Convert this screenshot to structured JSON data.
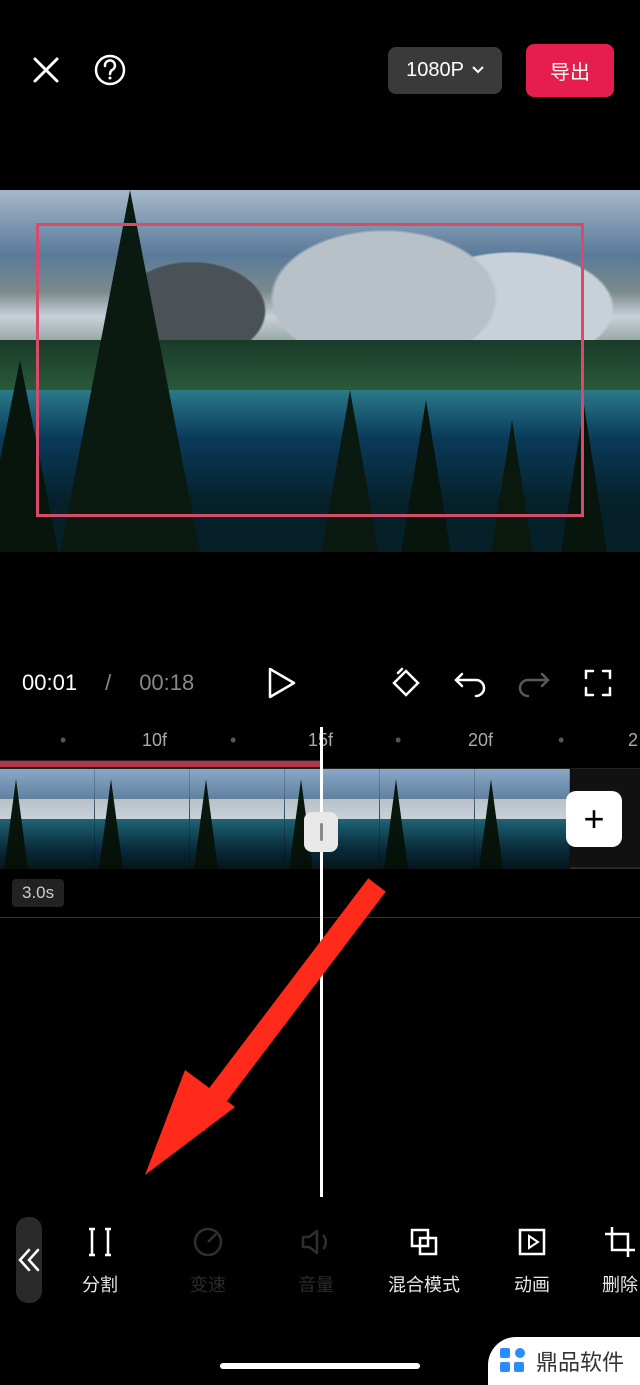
{
  "header": {
    "resolution_label": "1080P",
    "export_label": "导出"
  },
  "player": {
    "current_time": "00:01",
    "separator": "/",
    "total_time": "00:18"
  },
  "timeline": {
    "ruler": [
      "10f",
      "15f",
      "20f"
    ],
    "clip_duration": "3.0s",
    "add_label": "+"
  },
  "toolbar": {
    "items": [
      {
        "id": "split",
        "label": "分割",
        "disabled": false
      },
      {
        "id": "speed",
        "label": "变速",
        "disabled": true
      },
      {
        "id": "volume",
        "label": "音量",
        "disabled": true
      },
      {
        "id": "blend",
        "label": "混合模式",
        "disabled": false
      },
      {
        "id": "anim",
        "label": "动画",
        "disabled": false
      },
      {
        "id": "delete",
        "label": "删除",
        "disabled": false
      }
    ]
  },
  "watermark": {
    "text": "鼎品软件"
  }
}
